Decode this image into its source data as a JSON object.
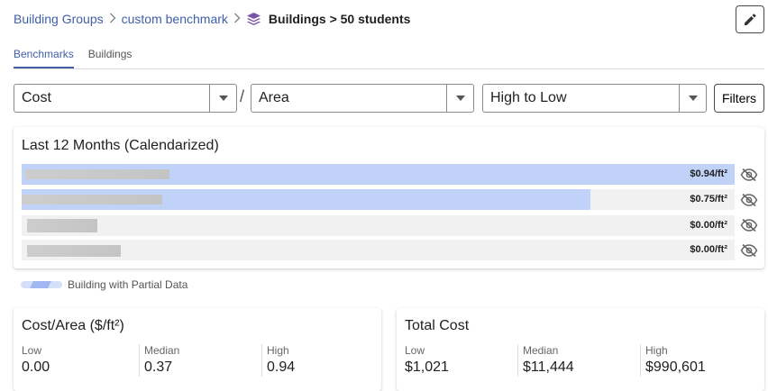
{
  "breadcrumb": {
    "items": [
      "Building Groups",
      "custom benchmark"
    ],
    "current": "Buildings > 50 students",
    "separator": ">"
  },
  "tabs": [
    {
      "label": "Benchmarks",
      "active": true
    },
    {
      "label": "Buildings",
      "active": false
    }
  ],
  "controls": {
    "metric": "Cost",
    "divider": "/",
    "normalizer": "Area",
    "sort": "High to Low",
    "filters_label": "Filters"
  },
  "chart": {
    "title": "Last 12 Months (Calendarized)",
    "bars": [
      {
        "value_label": "$0.94/ft²",
        "value": 0.94
      },
      {
        "value_label": "$0.75/ft²",
        "value": 0.75
      },
      {
        "value_label": "$0.00/ft²",
        "value": 0.0
      },
      {
        "value_label": "$0.00/ft²",
        "value": 0.0
      }
    ],
    "legend_label": "Building with Partial Data"
  },
  "stats": {
    "cost_area": {
      "title": "Cost/Area ($/ft²)",
      "low_label": "Low",
      "low": "0.00",
      "median_label": "Median",
      "median": "0.37",
      "high_label": "High",
      "high": "0.94"
    },
    "total_cost": {
      "title": "Total Cost",
      "low_label": "Low",
      "low": "$1,021",
      "median_label": "Median",
      "median": "$11,444",
      "high_label": "High",
      "high": "$990,601"
    }
  },
  "colors": {
    "accent": "#3f5fa8",
    "bar_fill": "#c1d2f8",
    "layers_icon": "#7b52ab"
  },
  "icons": {
    "edit": "pencil-icon",
    "layers": "layers-icon",
    "dropdown": "caret-down-icon",
    "hide": "eye-slash-icon"
  }
}
